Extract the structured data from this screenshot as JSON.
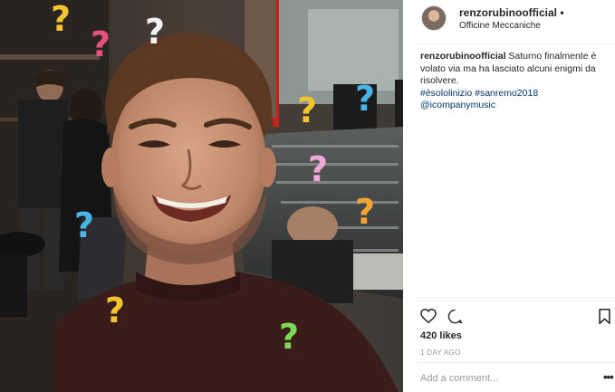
{
  "post": {
    "username": "renzorubinoofficial",
    "dot": "•",
    "location": "Officine Meccaniche",
    "caption": {
      "user": "renzorubinoofficial",
      "text": " Saturno finalmente è volato via ma ha lasciato alcuni enigmi da risolvere.",
      "tags": "#èsololinizio #sanremo2018",
      "mention": "@icompanymusic"
    },
    "likes": "420 likes",
    "timestamp": "1 DAY AGO",
    "comment_placeholder": "Add a comment...",
    "more_label": "•••"
  },
  "icons": [
    "heart-icon",
    "comment-icon",
    "bookmark-icon",
    "more-options-icon"
  ],
  "colors": {
    "link": "#003569",
    "muted": "#999999",
    "text": "#262626",
    "divider": "#efefef"
  }
}
